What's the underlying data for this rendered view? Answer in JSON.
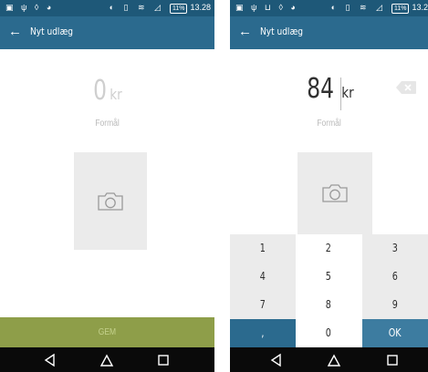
{
  "left_screen": {
    "status": {
      "left_icons": "▣ ψ ◊ ◕",
      "right_icons": "◐ ▯ ≋ ◿",
      "battery": "11%",
      "time": "13.28"
    },
    "appbar": {
      "back_icon": "arrow-left-icon",
      "title": "Nyt udlæg"
    },
    "amount": "0",
    "currency": "kr",
    "purpose_placeholder": "Formål",
    "photo_icon": "camera-icon",
    "save_label": "GEM",
    "save_color": "#8e9e49"
  },
  "right_screen": {
    "status": {
      "left_icons": "▣ ψ ⊔ ◊ ◕",
      "right_icons": "◐ ▯ ≋ ◿",
      "battery": "11%",
      "time": "13.2"
    },
    "appbar": {
      "back_icon": "arrow-left-icon",
      "title": "Nyt udlæg"
    },
    "amount": "84",
    "currency": "kr",
    "purpose_placeholder": "Formål",
    "photo_icon": "camera-icon",
    "backspace_icon": "backspace-icon",
    "keypad": {
      "row1": [
        "1",
        "2",
        "3"
      ],
      "row2": [
        "4",
        "5",
        "6"
      ],
      "row3": [
        "7",
        "8",
        "9"
      ],
      "row4": [
        ",",
        "0",
        "OK"
      ]
    }
  },
  "navbar": {
    "back_icon": "nav-back-icon",
    "home_icon": "nav-home-icon",
    "recents_icon": "nav-recents-icon"
  },
  "colors": {
    "statusbar": "#1e5878",
    "appbar": "#2b6a8e",
    "accent_green": "#8e9e49",
    "navbar": "#0a0a0a"
  }
}
